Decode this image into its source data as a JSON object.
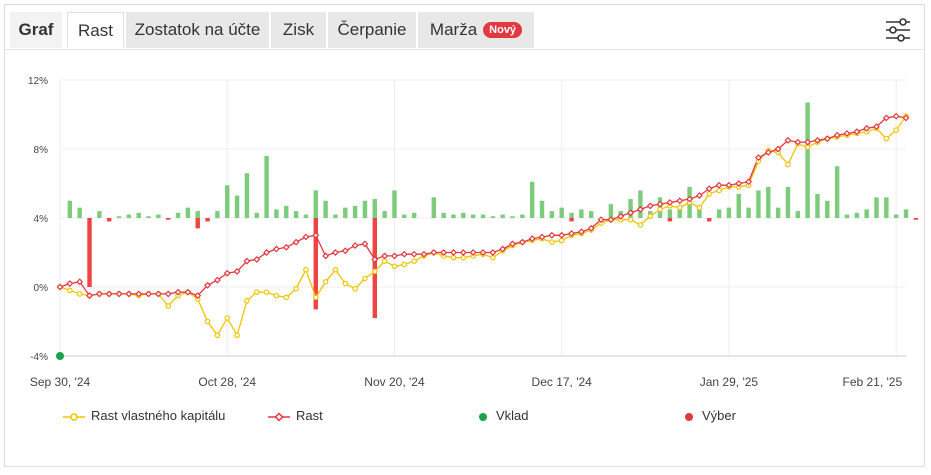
{
  "tabs": [
    {
      "label": "Graf",
      "kind": "title"
    },
    {
      "label": "Rast",
      "kind": "active"
    },
    {
      "label": "Zostatok na účte",
      "kind": "normal"
    },
    {
      "label": "Zisk",
      "kind": "normal"
    },
    {
      "label": "Čerpanie",
      "kind": "normal"
    },
    {
      "label": "Marža",
      "kind": "normal",
      "badge": "Nový"
    }
  ],
  "settings_icon": "sliders-icon",
  "colors": {
    "equity_line": "#f2c300",
    "growth_line": "#e2383f",
    "bar_positive": "#7dcc7d",
    "bar_negative": "#ef4444",
    "deposit": "#1aa34a",
    "withdrawal": "#e2383f",
    "grid": "#eeeeee"
  },
  "chart_data": {
    "type": "line",
    "ylim": [
      -4,
      12
    ],
    "y_ticks": [
      "12%",
      "8%",
      "4%",
      "0%",
      "-4%"
    ],
    "y_tick_values": [
      12,
      8,
      4,
      0,
      -4
    ],
    "x_tick_labels": [
      "Sep 30, '24",
      "Oct 28, '24",
      "Nov 20, '24",
      "Dec 17, '24",
      "Jan 29, '25",
      "Feb 21, '25"
    ],
    "x_tick_index": [
      0,
      17,
      34,
      51,
      68,
      85
    ],
    "legend": [
      "Rast vlastného kapitálu",
      "Rast",
      "Vklad",
      "Výber"
    ],
    "series": [
      {
        "name": "Rast vlastného kapitálu",
        "values": [
          0.0,
          -0.2,
          -0.4,
          -0.5,
          -0.4,
          -0.4,
          -0.4,
          -0.4,
          -0.5,
          -0.4,
          -0.4,
          -1.1,
          -0.5,
          -0.3,
          -0.7,
          -2.0,
          -2.8,
          -1.8,
          -2.8,
          -0.8,
          -0.3,
          -0.3,
          -0.5,
          -0.6,
          -0.1,
          1.0,
          -0.6,
          0.3,
          1.0,
          0.2,
          -0.1,
          0.5,
          0.9,
          1.5,
          1.2,
          1.3,
          1.5,
          1.8,
          2.0,
          1.8,
          1.7,
          1.7,
          1.8,
          1.9,
          1.7,
          2.1,
          2.4,
          2.6,
          2.7,
          2.8,
          2.6,
          2.7,
          3.0,
          3.1,
          3.3,
          3.7,
          3.9,
          3.9,
          3.9,
          3.6,
          4.1,
          4.5,
          4.7,
          4.6,
          4.9,
          4.6,
          5.4,
          5.6,
          5.8,
          5.8,
          5.9,
          7.3,
          7.9,
          7.8,
          7.1,
          8.3,
          8.1,
          8.4,
          8.6,
          8.7,
          8.8,
          8.9,
          9.0,
          9.2,
          8.6,
          9.1,
          9.9
        ],
        "style": "line-circle-markers"
      },
      {
        "name": "Rast",
        "values": [
          0.0,
          0.2,
          0.3,
          -0.5,
          -0.4,
          -0.4,
          -0.4,
          -0.4,
          -0.4,
          -0.4,
          -0.4,
          -0.4,
          -0.3,
          -0.3,
          -0.5,
          0.1,
          0.4,
          0.8,
          0.9,
          1.5,
          1.6,
          2.0,
          2.2,
          2.3,
          2.6,
          2.9,
          3.0,
          1.8,
          2.0,
          2.1,
          2.4,
          2.5,
          1.6,
          1.8,
          1.8,
          1.9,
          1.9,
          1.9,
          2.0,
          2.0,
          2.0,
          2.0,
          2.0,
          2.0,
          2.0,
          2.2,
          2.5,
          2.6,
          2.8,
          2.9,
          3.0,
          3.0,
          3.1,
          3.2,
          3.4,
          3.9,
          3.9,
          4.1,
          4.3,
          4.5,
          4.7,
          4.8,
          4.9,
          5.0,
          5.1,
          5.3,
          5.7,
          5.9,
          5.9,
          6.0,
          6.1,
          7.5,
          7.8,
          8.0,
          8.5,
          8.4,
          8.4,
          8.5,
          8.6,
          8.8,
          8.9,
          9.0,
          9.2,
          9.3,
          9.8,
          9.9,
          9.8
        ],
        "style": "line-diamond-markers"
      }
    ],
    "bars_baseline": 4,
    "bars": [
      {
        "i": 1,
        "v": 5.0
      },
      {
        "i": 2,
        "v": 4.6
      },
      {
        "i": 4,
        "v": 4.4
      },
      {
        "i": 5,
        "v": 3.8
      },
      {
        "i": 6,
        "v": 4.1
      },
      {
        "i": 7,
        "v": 4.2
      },
      {
        "i": 8,
        "v": 4.3
      },
      {
        "i": 9,
        "v": 4.1
      },
      {
        "i": 10,
        "v": 4.2
      },
      {
        "i": 11,
        "v": 3.9
      },
      {
        "i": 12,
        "v": 4.3
      },
      {
        "i": 13,
        "v": 4.6
      },
      {
        "i": 14,
        "v": 4.4
      },
      {
        "i": 15,
        "v": 3.8
      },
      {
        "i": 16,
        "v": 4.4
      },
      {
        "i": 17,
        "v": 5.9
      },
      {
        "i": 18,
        "v": 5.3
      },
      {
        "i": 19,
        "v": 6.6
      },
      {
        "i": 20,
        "v": 4.3
      },
      {
        "i": 21,
        "v": 7.6
      },
      {
        "i": 22,
        "v": 4.5
      },
      {
        "i": 23,
        "v": 4.7
      },
      {
        "i": 24,
        "v": 4.4
      },
      {
        "i": 25,
        "v": 4.2
      },
      {
        "i": 26,
        "v": 5.6
      },
      {
        "i": 27,
        "v": 5.0
      },
      {
        "i": 28,
        "v": 4.2
      },
      {
        "i": 29,
        "v": 4.6
      },
      {
        "i": 30,
        "v": 4.7
      },
      {
        "i": 31,
        "v": 5.0
      },
      {
        "i": 32,
        "v": 5.1
      },
      {
        "i": 33,
        "v": 4.4
      },
      {
        "i": 34,
        "v": 5.6
      },
      {
        "i": 35,
        "v": 4.2
      },
      {
        "i": 36,
        "v": 4.3
      },
      {
        "i": 38,
        "v": 5.2
      },
      {
        "i": 39,
        "v": 4.3
      },
      {
        "i": 40,
        "v": 4.2
      },
      {
        "i": 41,
        "v": 4.3
      },
      {
        "i": 42,
        "v": 4.2
      },
      {
        "i": 43,
        "v": 4.2
      },
      {
        "i": 44,
        "v": 4.1
      },
      {
        "i": 45,
        "v": 4.2
      },
      {
        "i": 46,
        "v": 4.1
      },
      {
        "i": 47,
        "v": 4.2
      },
      {
        "i": 48,
        "v": 6.1
      },
      {
        "i": 49,
        "v": 5.0
      },
      {
        "i": 50,
        "v": 4.4
      },
      {
        "i": 51,
        "v": 4.6
      },
      {
        "i": 52,
        "v": 4.3
      },
      {
        "i": 53,
        "v": 4.5
      },
      {
        "i": 54,
        "v": 4.4
      },
      {
        "i": 55,
        "v": 3.8
      },
      {
        "i": 56,
        "v": 4.8
      },
      {
        "i": 57,
        "v": 4.4
      },
      {
        "i": 58,
        "v": 5.1
      },
      {
        "i": 59,
        "v": 5.6
      },
      {
        "i": 60,
        "v": 4.4
      },
      {
        "i": 61,
        "v": 5.2
      },
      {
        "i": 62,
        "v": 4.5
      },
      {
        "i": 63,
        "v": 4.6
      },
      {
        "i": 64,
        "v": 5.8
      },
      {
        "i": 65,
        "v": 4.6
      },
      {
        "i": 66,
        "v": 3.8
      },
      {
        "i": 67,
        "v": 4.5
      },
      {
        "i": 68,
        "v": 4.6
      },
      {
        "i": 69,
        "v": 5.4
      },
      {
        "i": 70,
        "v": 4.6
      },
      {
        "i": 71,
        "v": 5.6
      },
      {
        "i": 72,
        "v": 5.8
      },
      {
        "i": 73,
        "v": 4.6
      },
      {
        "i": 74,
        "v": 5.8
      },
      {
        "i": 75,
        "v": 4.4
      },
      {
        "i": 76,
        "v": 10.7
      },
      {
        "i": 77,
        "v": 5.4
      },
      {
        "i": 78,
        "v": 5.0
      },
      {
        "i": 79,
        "v": 7.0
      },
      {
        "i": 80,
        "v": 4.2
      },
      {
        "i": 81,
        "v": 4.3
      },
      {
        "i": 82,
        "v": 4.5
      },
      {
        "i": 83,
        "v": 5.2
      },
      {
        "i": 84,
        "v": 5.2
      },
      {
        "i": 85,
        "v": 4.2
      },
      {
        "i": 86,
        "v": 4.5
      }
    ],
    "withdrawal_bars": [
      {
        "i": 3,
        "v": 0.0
      },
      {
        "i": 14,
        "v": 3.4
      },
      {
        "i": 26,
        "v": -1.3
      },
      {
        "i": 32,
        "v": -1.8
      },
      {
        "i": 52,
        "v": 3.8
      },
      {
        "i": 62,
        "v": 3.8
      },
      {
        "i": 87,
        "v": 3.9
      }
    ],
    "deposits": [
      {
        "i": 0,
        "v": -4
      }
    ]
  }
}
